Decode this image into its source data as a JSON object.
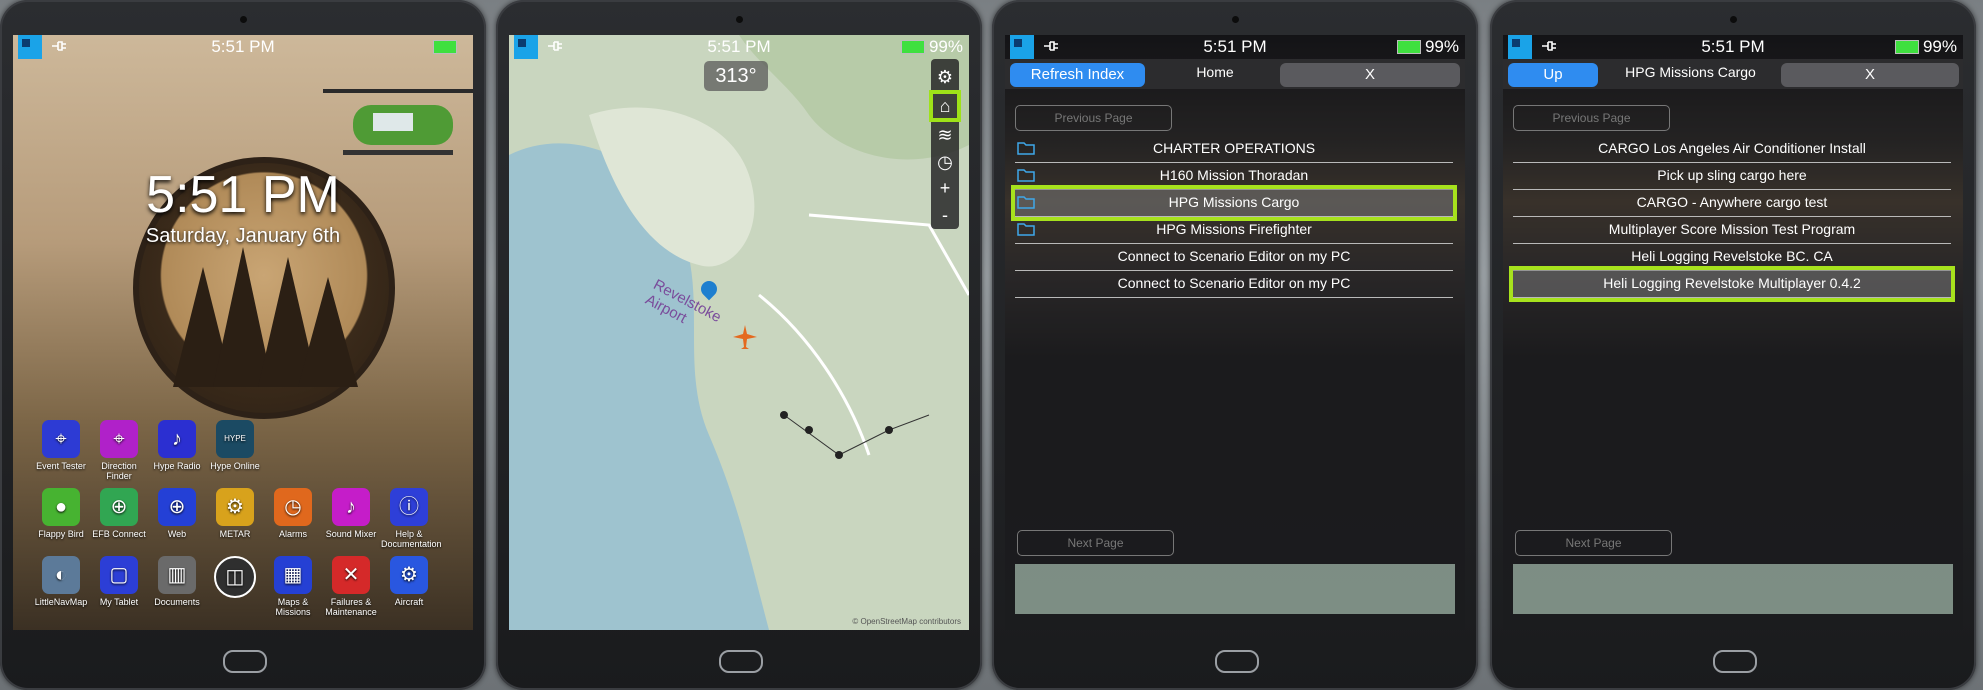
{
  "status": {
    "time": "5:51 PM",
    "battery": "99%",
    "battery_color": "#3fe03f"
  },
  "home": {
    "big_time": "5:51 PM",
    "date": "Saturday, January 6th",
    "apps": [
      {
        "label": "Event Tester",
        "color": "#2d3bd4",
        "glyph": "⌖"
      },
      {
        "label": "Direction Finder",
        "color": "#b021c9",
        "glyph": "⌖"
      },
      {
        "label": "Hype Radio",
        "color": "#2b2fd1",
        "glyph": "♪"
      },
      {
        "label": "Hype Online",
        "color": "#1b4a63",
        "glyph": "HYPE"
      },
      {
        "label": "Flappy Bird",
        "color": "#47b331",
        "glyph": "●"
      },
      {
        "label": "EFB Connect",
        "color": "#31a652",
        "glyph": "⊕"
      },
      {
        "label": "Web",
        "color": "#2440d6",
        "glyph": "⊕"
      },
      {
        "label": "METAR",
        "color": "#d8a21c",
        "glyph": "⚙"
      },
      {
        "label": "Alarms",
        "color": "#e0681d",
        "glyph": "◷"
      },
      {
        "label": "Sound Mixer",
        "color": "#c51dc9",
        "glyph": "♪"
      },
      {
        "label": "Help & Documentation",
        "color": "#2e3fd8",
        "glyph": "ⓘ"
      },
      {
        "label": "LittleNavMap",
        "color": "#5c7a99",
        "glyph": "◐"
      },
      {
        "label": "My Tablet",
        "color": "#2c3ed6",
        "glyph": "▢"
      },
      {
        "label": "Documents",
        "color": "#6a6a6a",
        "glyph": "▥"
      },
      {
        "label": "",
        "color": "#2f2f2f",
        "glyph": "◫"
      },
      {
        "label": "Maps & Missions",
        "color": "#2540d4",
        "glyph": "▦"
      },
      {
        "label": "Failures & Maintenance",
        "color": "#d52929",
        "glyph": "✕"
      },
      {
        "label": "Aircraft",
        "color": "#2957e0",
        "glyph": "⚙"
      }
    ]
  },
  "map": {
    "heading": "313°",
    "airport_label": "Revelstoke Airport",
    "attribution": "© OpenStreetMap contributors",
    "tools": [
      "gear-icon",
      "museum-icon",
      "layers-icon",
      "compass-icon",
      "plus-icon",
      "minus-icon"
    ]
  },
  "index": {
    "refresh_label": "Refresh Index",
    "title": "Home",
    "close_label": "X",
    "prev_label": "Previous Page",
    "next_label": "Next Page",
    "rows": [
      {
        "label": "CHARTER OPERATIONS",
        "folder": true
      },
      {
        "label": "H160 Mission Thoradan",
        "folder": true
      },
      {
        "label": "HPG Missions Cargo",
        "folder": true,
        "selected": true
      },
      {
        "label": "HPG Missions Firefighter",
        "folder": true
      },
      {
        "label": "Connect to Scenario Editor on my PC",
        "folder": false
      },
      {
        "label": "Connect to Scenario Editor on my PC",
        "folder": false
      }
    ]
  },
  "cargo": {
    "up_label": "Up",
    "title": "HPG Missions Cargo",
    "close_label": "X",
    "prev_label": "Previous Page",
    "next_label": "Next Page",
    "rows": [
      {
        "label": "CARGO Los Angeles Air Conditioner Install"
      },
      {
        "label": "Pick up sling cargo here"
      },
      {
        "label": "CARGO - Anywhere cargo test"
      },
      {
        "label": "Multiplayer Score Mission Test Program"
      },
      {
        "label": "Heli Logging Revelstoke BC. CA"
      },
      {
        "label": "Heli Logging Revelstoke Multiplayer 0.4.2",
        "selected": true
      }
    ]
  },
  "accent_highlight": "#a7e21d"
}
